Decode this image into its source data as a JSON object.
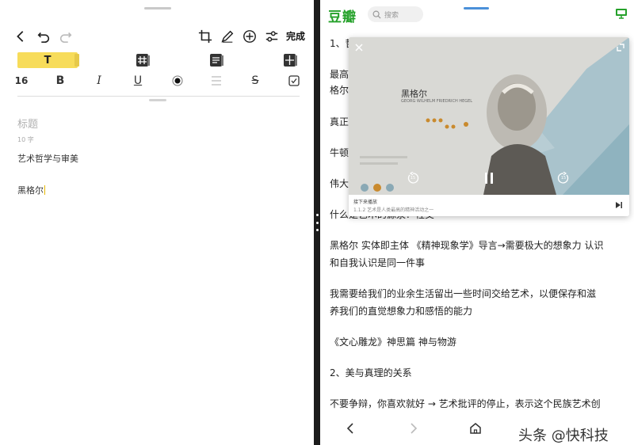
{
  "editor": {
    "done_label": "完成",
    "text_style_label": "T",
    "font_size": "16",
    "bold_label": "B",
    "italic_label": "I",
    "underline_label": "U",
    "strike_label": "S",
    "title_placeholder": "标题",
    "char_count": "10 字",
    "lines": [
      "艺术哲学与审美",
      "黑格尔"
    ],
    "highlight_color": "#f7dc5a"
  },
  "browser": {
    "logo": "豆瓣",
    "search_placeholder": "搜索",
    "brand_color": "#25a12a",
    "paragraphs": [
      "1、哲",
      "最高",
      "格尔",
      "真正",
      "牛顿",
      "伟大",
      "什么是艺术的源泉？社交",
      "黑格尔 实体即主体 《精神现象学》导言→需要极大的想象力 认识",
      "和自我认识是同一件事",
      "我需要给我们的业余生活留出一些时间交给艺术，以便保存和滋",
      "养我们的直觉想象力和感悟的能力",
      "《文心雕龙》神思篇 神与物游",
      "2、美与真理的关系",
      "不要争辩，你喜欢就好 → 艺术批评的停止，表示这个民族艺术创"
    ],
    "video": {
      "person_name": "黑格尔",
      "person_name_en": "GEORG WILHELM FRIEDRICH HEGEL",
      "up_next_label": "接下来播放",
      "up_next_title": "1.1.2 艺术是人类最高的精神活动之一",
      "rewind_label": "15",
      "forward_label": "15"
    }
  },
  "watermark": "头条 @快科技"
}
